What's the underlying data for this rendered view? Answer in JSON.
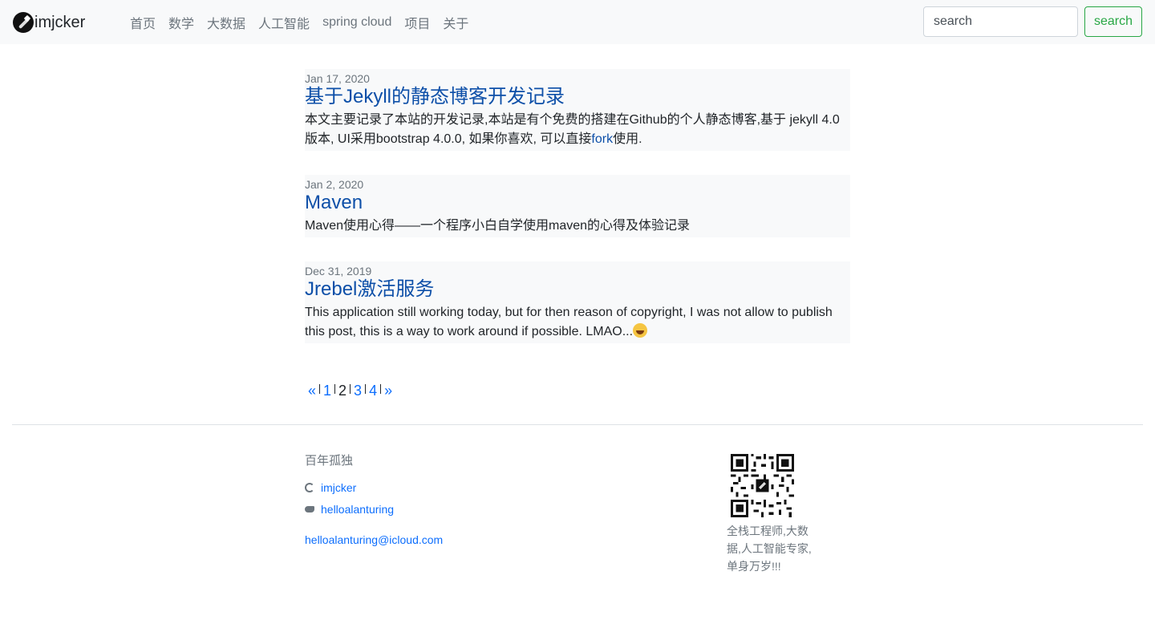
{
  "navbar": {
    "brand": "imjcker",
    "links": [
      "首页",
      "数学",
      "大数据",
      "人工智能",
      "spring cloud",
      "项目",
      "关于"
    ],
    "search_placeholder": "search",
    "search_button": "search"
  },
  "posts": [
    {
      "date": "Jan 17, 2020",
      "title": "基于Jekyll的静态博客开发记录",
      "excerpt_before": "本文主要记录了本站的开发记录,本站是有个免费的搭建在Github的个人静态博客,基于 jekyll 4.0版本, UI采用bootstrap 4.0.0, 如果你喜欢, 可以直接",
      "excerpt_link": "fork",
      "excerpt_after": "使用."
    },
    {
      "date": "Jan 2, 2020",
      "title": "Maven",
      "excerpt": "Maven使用心得——一个程序小白自学使用maven的心得及体验记录"
    },
    {
      "date": "Dec 31, 2019",
      "title": "Jrebel激活服务",
      "excerpt": "This application still working today, but for then reason of copyright, I was not allow to publish this post, this is a way to work around if possible. LMAO..."
    }
  ],
  "pagination": {
    "prev": "«",
    "pages": [
      "1",
      "2",
      "3",
      "4"
    ],
    "current": "2",
    "next": "»"
  },
  "footer": {
    "title": "百年孤独",
    "github": "imjcker",
    "twitter": "helloalanturing",
    "email": "helloalanturing@icloud.com",
    "qr_description": "全栈工程师,大数据,人工智能专家,单身万岁!!!"
  },
  "colors": {
    "link": "#0d4fa8",
    "search_button": "#28a745",
    "navbar_bg": "#f8f9fa"
  }
}
